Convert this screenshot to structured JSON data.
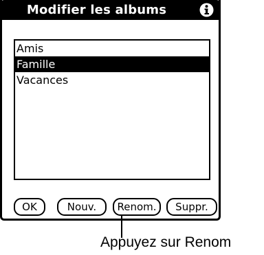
{
  "dialog": {
    "title": "Modifier les albums",
    "info_icon": "info-icon"
  },
  "albums": {
    "items": [
      {
        "label": "Amis",
        "selected": false
      },
      {
        "label": "Famille",
        "selected": true
      },
      {
        "label": "Vacances",
        "selected": false
      }
    ]
  },
  "buttons": {
    "ok": "OK",
    "new": "Nouv.",
    "rename": "Renom.",
    "delete": "Suppr."
  },
  "callout": {
    "text": "Appuyez sur Renom"
  }
}
